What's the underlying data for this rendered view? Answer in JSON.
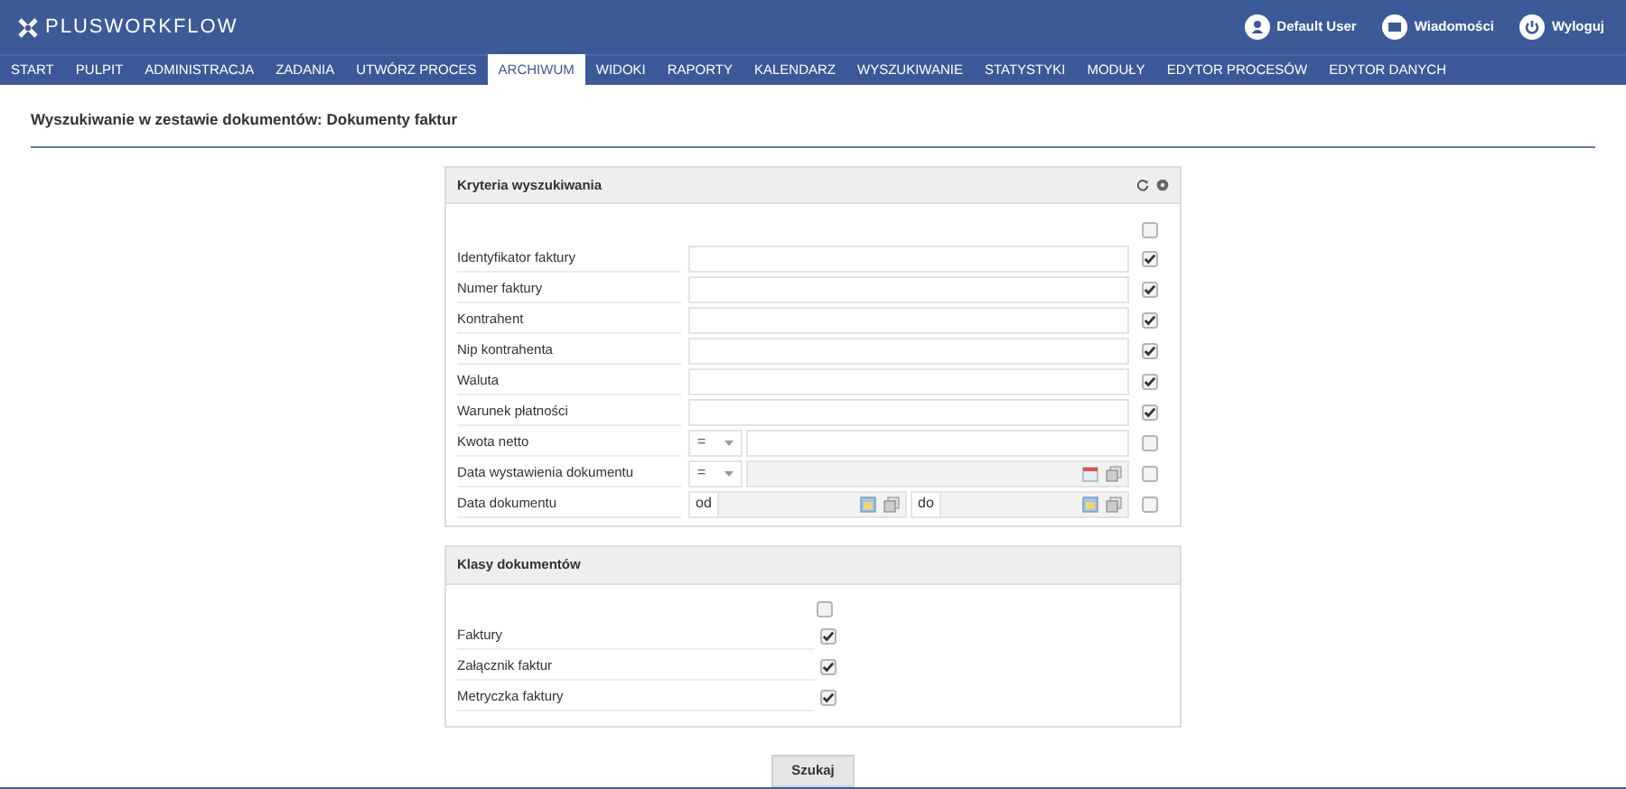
{
  "app": {
    "logo": "PLUSWORKFLOW",
    "user_links": [
      {
        "kind": "user",
        "label": "Default User"
      },
      {
        "kind": "messages",
        "label": "Wiadomości"
      },
      {
        "kind": "logout",
        "label": "Wyloguj"
      }
    ]
  },
  "nav": [
    {
      "label": "START",
      "selected": false
    },
    {
      "label": "PULPIT",
      "selected": false
    },
    {
      "label": "ADMINISTRACJA",
      "selected": false
    },
    {
      "label": "ZADANIA",
      "selected": false
    },
    {
      "label": "UTWÓRZ PROCES",
      "selected": false
    },
    {
      "label": "ARCHIWUM",
      "selected": true
    },
    {
      "label": "WIDOKI",
      "selected": false
    },
    {
      "label": "RAPORTY",
      "selected": false
    },
    {
      "label": "KALENDARZ",
      "selected": false
    },
    {
      "label": "WYSZUKIWANIE",
      "selected": false
    },
    {
      "label": "STATYSTYKI",
      "selected": false
    },
    {
      "label": "MODUŁY",
      "selected": false
    },
    {
      "label": "EDYTOR PROCESÓW",
      "selected": false
    },
    {
      "label": "EDYTOR DANYCH",
      "selected": false
    }
  ],
  "page_title": "Wyszukiwanie w zestawie dokumentów: Dokumenty faktur",
  "criteria": {
    "title": "Kryteria wyszukiwania",
    "all_checked": false,
    "fields": [
      {
        "kind": "text",
        "label": "Identyfikator faktury",
        "checked": true
      },
      {
        "kind": "text",
        "label": "Numer faktury",
        "checked": true
      },
      {
        "kind": "text",
        "label": "Kontrahent",
        "checked": true
      },
      {
        "kind": "text",
        "label": "Nip kontrahenta",
        "checked": true
      },
      {
        "kind": "text",
        "label": "Waluta",
        "checked": true
      },
      {
        "kind": "text",
        "label": "Warunek płatności",
        "checked": true
      },
      {
        "kind": "operator",
        "label": "Kwota netto",
        "operator": "=",
        "checked": false
      },
      {
        "kind": "date_operator",
        "label": "Data wystawienia dokumentu",
        "operator": "=",
        "checked": false
      },
      {
        "kind": "date_range",
        "label": "Data dokumentu",
        "from_label": "od",
        "to_label": "do",
        "checked": false
      }
    ]
  },
  "classes": {
    "title": "Klasy dokumentów",
    "all_checked": false,
    "items": [
      {
        "label": "Faktury",
        "checked": true
      },
      {
        "label": "Załącznik faktur",
        "checked": true
      },
      {
        "label": "Metryczka faktury",
        "checked": true
      }
    ]
  },
  "search_button": "Szukaj"
}
